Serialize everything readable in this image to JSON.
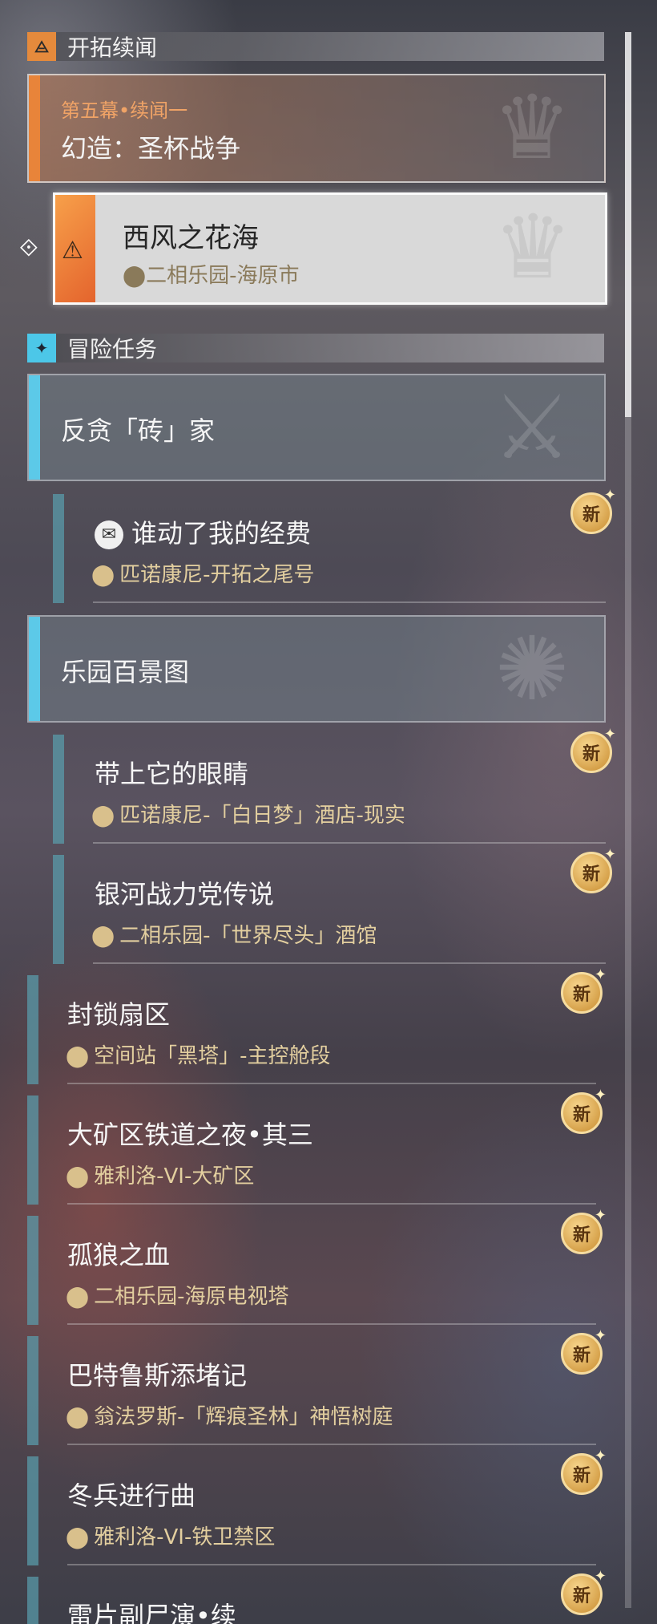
{
  "section_trailblaze": {
    "title": "开拓续闻",
    "icon": "trailblaze-icon"
  },
  "main_quest": {
    "subtitle": "第五幕•续闻一",
    "title": "幻造：圣杯战争"
  },
  "selected_quest": {
    "title": "西风之花海",
    "location": "二相乐园-海原市"
  },
  "section_adventure": {
    "title": "冒险任务",
    "icon": "adventure-icon"
  },
  "categories": [
    {
      "title": "反贪「砖」家"
    },
    {
      "title": "乐园百景图"
    }
  ],
  "new_badge": "新",
  "quests": [
    {
      "title": "谁动了我的经费",
      "location": "匹诺康尼-开拓之尾号"
    },
    {
      "title": "带上它的眼睛",
      "location": "匹诺康尼-「白日梦」酒店-现实"
    },
    {
      "title": "银河战力党传说",
      "location": "二相乐园-「世界尽头」酒馆"
    },
    {
      "title": "封锁扇区",
      "location": "空间站「黑塔」-主控舱段"
    },
    {
      "title": "大矿区铁道之夜•其三",
      "location": "雅利洛-VI-大矿区"
    },
    {
      "title": "孤狼之血",
      "location": "二相乐园-海原电视塔"
    },
    {
      "title": "巴特鲁斯添堵记",
      "location": "翁法罗斯-「辉痕圣林」神悟树庭"
    },
    {
      "title": "冬兵进行曲",
      "location": "雅利洛-VI-铁卫禁区"
    },
    {
      "title": "雷片副尸演•续",
      "location": ""
    }
  ],
  "colors": {
    "accent_orange": "#e8843a",
    "accent_blue": "#5cc9e8",
    "badge_gold": "#c88b2e"
  }
}
